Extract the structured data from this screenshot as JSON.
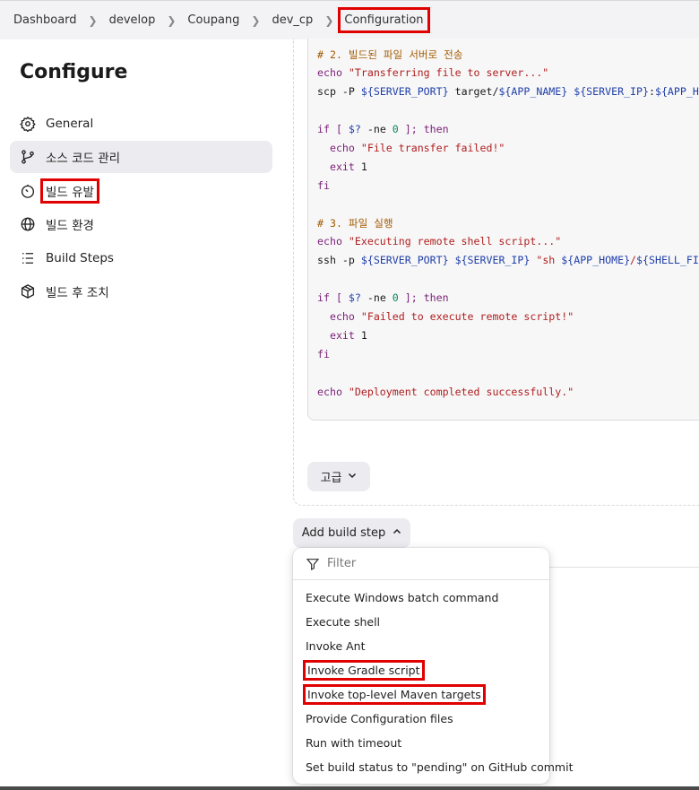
{
  "breadcrumb": {
    "items": [
      "Dashboard",
      "develop",
      "Coupang",
      "dev_cp"
    ],
    "current": "Configuration"
  },
  "sidebar": {
    "title": "Configure",
    "items": [
      {
        "label": "General",
        "icon": "gear-icon"
      },
      {
        "label": "소스 코드 관리",
        "icon": "source-branch-icon"
      },
      {
        "label": "빌드 유발",
        "icon": "timer-icon"
      },
      {
        "label": "빌드 환경",
        "icon": "globe-icon"
      },
      {
        "label": "Build Steps",
        "icon": "list-icon"
      },
      {
        "label": "빌드 후 조치",
        "icon": "package-icon"
      }
    ]
  },
  "code": {
    "lines": [
      "# 2. 빌드된 파일 서버로 전송",
      "echo \"Transferring file to server...\"",
      "scp -P ${SERVER_PORT} target/${APP_NAME} ${SERVER_IP}:${APP_HO",
      "",
      "if [ $? -ne 0 ]; then",
      "  echo \"File transfer failed!\"",
      "  exit 1",
      "fi",
      "",
      "# 3. 파일 실행",
      "echo \"Executing remote shell script...\"",
      "ssh -p ${SERVER_PORT} ${SERVER_IP} \"sh ${APP_HOME}/${SHELL_FIL",
      "",
      "if [ $? -ne 0 ]; then",
      "  echo \"Failed to execute remote script!\"",
      "  exit 1",
      "fi",
      "",
      "echo \"Deployment completed successfully.\""
    ]
  },
  "advanced_button": {
    "label": "고급"
  },
  "add_build_step": {
    "label": "Add build step"
  },
  "dropdown": {
    "filter_placeholder": "Filter",
    "items": [
      "Execute Windows batch command",
      "Execute shell",
      "Invoke Ant",
      "Invoke Gradle script",
      "Invoke top-level Maven targets",
      "Provide Configuration files",
      "Run with timeout",
      "Set build status to \"pending\" on GitHub commit"
    ]
  },
  "colors": {
    "highlight": "#e00000",
    "comment": "#a35b00",
    "string": "#b01e1e",
    "keyword": "#7a1f76",
    "variable": "#1f3fa8"
  }
}
